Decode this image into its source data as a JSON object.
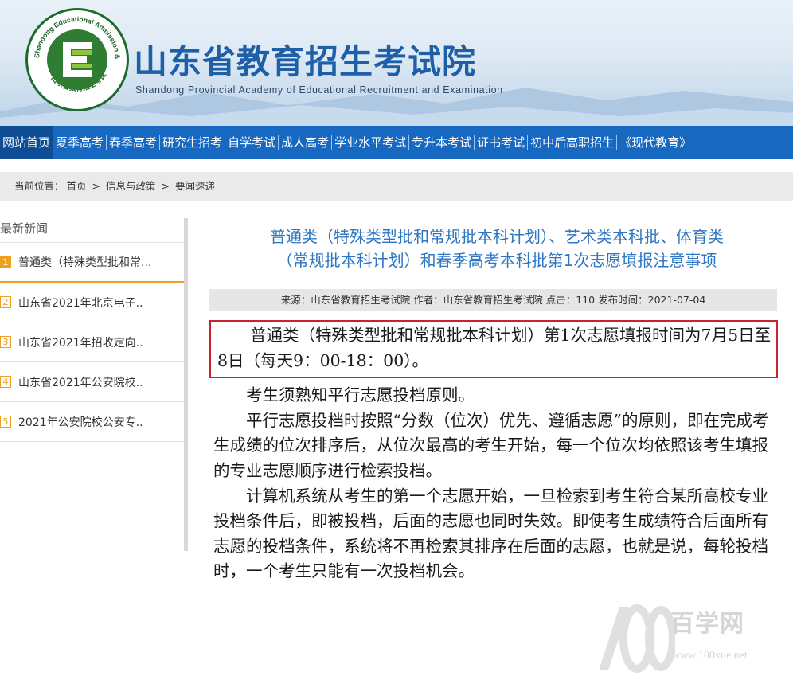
{
  "header": {
    "title_cn": "山东省教育招生考试院",
    "title_en": "Shandong Provincial Academy of Educational Recruitment and Examination",
    "logo_ring_text": "Shandong Educational Admission & Examinations",
    "logo_bottom_text": "山东省教育招生考试",
    "logo_letter": "E"
  },
  "nav": {
    "items": [
      "网站首页",
      "夏季高考",
      "春季高考",
      "研究生招考",
      "自学考试",
      "成人高考",
      "学业水平考试",
      "专升本考试",
      "证书考试",
      "初中后高职招生",
      "《现代教育》"
    ],
    "active_index": 0
  },
  "breadcrumb": {
    "label": "当前位置：",
    "items": [
      "首页",
      "信息与政策",
      "要闻速递"
    ],
    "separator": ">"
  },
  "sidebar": {
    "title": "最新新闻",
    "items": [
      {
        "num": "1",
        "text": "普通类（特殊类型批和常..."
      },
      {
        "num": "2",
        "text": "山东省2021年北京电子.."
      },
      {
        "num": "3",
        "text": "山东省2021年招收定向.."
      },
      {
        "num": "4",
        "text": "山东省2021年公安院校.."
      },
      {
        "num": "5",
        "text": "2021年公安院校公安专.."
      }
    ]
  },
  "article": {
    "title_line1": "普通类（特殊类型批和常规批本科计划）、艺术类本科批、体育类",
    "title_line2": "（常规批本科计划）和春季高考本科批第1次志愿填报注意事项",
    "meta": {
      "source_label": "来源：",
      "source": "山东省教育招生考试院",
      "author_label": "作者：",
      "author": "山东省教育招生考试院",
      "clicks_label": "点击：",
      "clicks": "110",
      "date_label": "发布时间：",
      "date": "2021-07-04"
    },
    "highlight": "普通类（特殊类型批和常规批本科计划）第1次志愿填报时间为7月5日至8日（每天9：00-18：00）。",
    "paragraphs": [
      "考生须熟知平行志愿投档原则。",
      "平行志愿投档时按照“分数（位次）优先、遵循志愿”的原则，即在完成考生成绩的位次排序后，从位次最高的考生开始，每一个位次均依照该考生填报的专业志愿顺序进行检索投档。",
      "计算机系统从考生的第一个志愿开始，一旦检索到考生符合某所高校专业投档条件后，即被投档，后面的志愿也同时失效。即使考生成绩符合后面所有志愿的投档条件，系统将不再检索其排序在后面的志愿，也就是说，每轮投档时，一个考生只能有一次投档机会。"
    ]
  },
  "watermark": {
    "cn": "百学网",
    "url": "www.100xue.net"
  },
  "colors": {
    "nav_bg": "#1668c0",
    "nav_active": "#0e4c94",
    "title_blue": "#2e75c2",
    "highlight_border": "#c9242d",
    "sidebar_accent": "#f0a020"
  }
}
